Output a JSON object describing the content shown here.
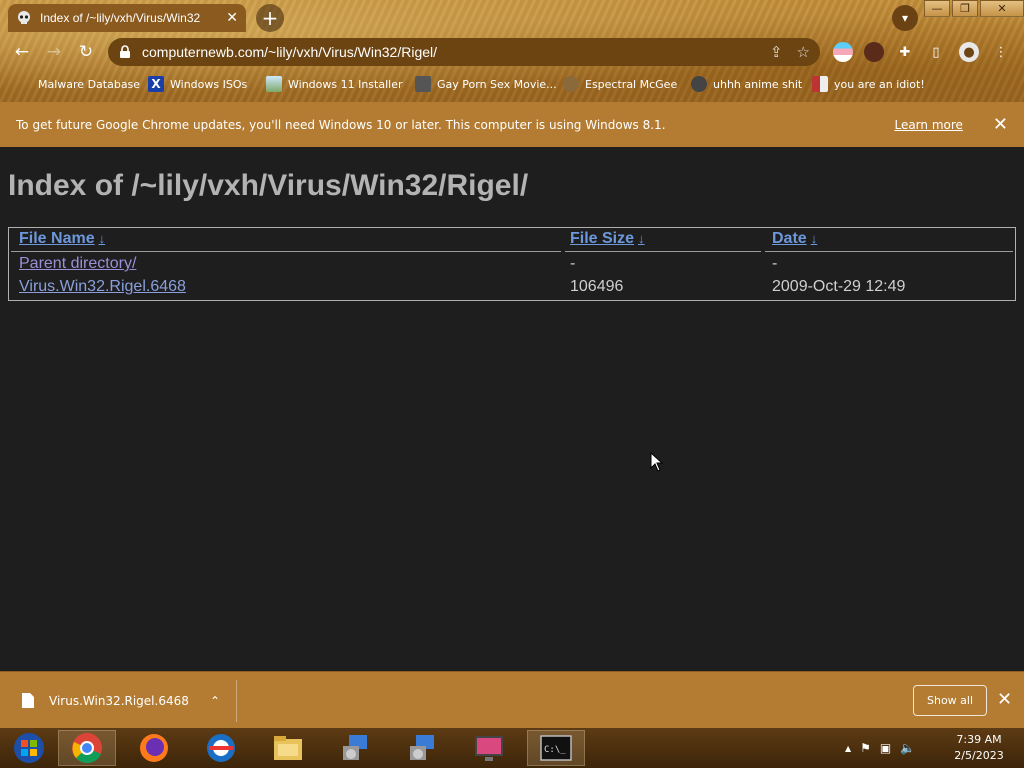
{
  "tab": {
    "title": "Index of /~lily/vxh/Virus/Win32",
    "close": "✕",
    "favicon": "skull-favicon-icon"
  },
  "new_tab": "+",
  "window": {
    "minimize": "—",
    "restore": "❐",
    "close": "✕"
  },
  "toolbar": {
    "back": "←",
    "forward": "→",
    "reload": "↻",
    "share": "⇪",
    "star": "☆",
    "extensions": "✚",
    "side_panel": "▯",
    "menu": "⋮"
  },
  "omnibox": {
    "url": "computernewb.com/~lily/vxh/Virus/Win32/Rigel/"
  },
  "bookmarks": [
    {
      "label": "Malware Database",
      "icon": "none",
      "color": ""
    },
    {
      "label": "Windows ISOs",
      "icon": "x-logo-icon",
      "color": "#1a3ea8"
    },
    {
      "label": "Windows 11 Installer",
      "icon": "image-icon",
      "color": "#7fa867"
    },
    {
      "label": "Gay Porn Sex Movie...",
      "icon": "skull-icon",
      "color": "#555555"
    },
    {
      "label": "Espectral McGee",
      "icon": "face-icon",
      "color": "#8a6a3a"
    },
    {
      "label": "uhhh anime shit",
      "icon": "anime-face-icon",
      "color": "#444444"
    },
    {
      "label": "you are an idiot!",
      "icon": "flag-icon",
      "color": "#b33333"
    }
  ],
  "infobar": {
    "text": "To get future Google Chrome updates, you'll need Windows 10 or later. This computer is using Windows 8.1.",
    "learn_more": "Learn more",
    "close": "✕"
  },
  "page": {
    "title": "Index of /~lily/vxh/Virus/Win32/Rigel/",
    "headers": {
      "name": "File Name",
      "size": "File Size",
      "date": "Date",
      "sort_arrow": "↓"
    },
    "rows": [
      {
        "name": "Parent directory/",
        "size": "-",
        "date": "-"
      },
      {
        "name": "Virus.Win32.Rigel.6468",
        "size": "106496",
        "date": "2009-Oct-29 12:49"
      }
    ]
  },
  "downloads": {
    "file": "Virus.Win32.Rigel.6468",
    "menu": "⌃",
    "show_all": "Show all",
    "close": "✕"
  },
  "taskbar": {
    "apps": [
      "start-orb-icon",
      "chrome-icon",
      "firefox-icon",
      "opera-icon",
      "file-explorer-icon",
      "setup-program-icon",
      "setup-program-icon",
      "media-display-icon",
      "command-prompt-icon"
    ],
    "tray": {
      "chevron": "▲",
      "flag": "⚑",
      "network": "▣",
      "volume": "🔈"
    },
    "time": "7:39 AM",
    "date": "2/5/2023"
  }
}
